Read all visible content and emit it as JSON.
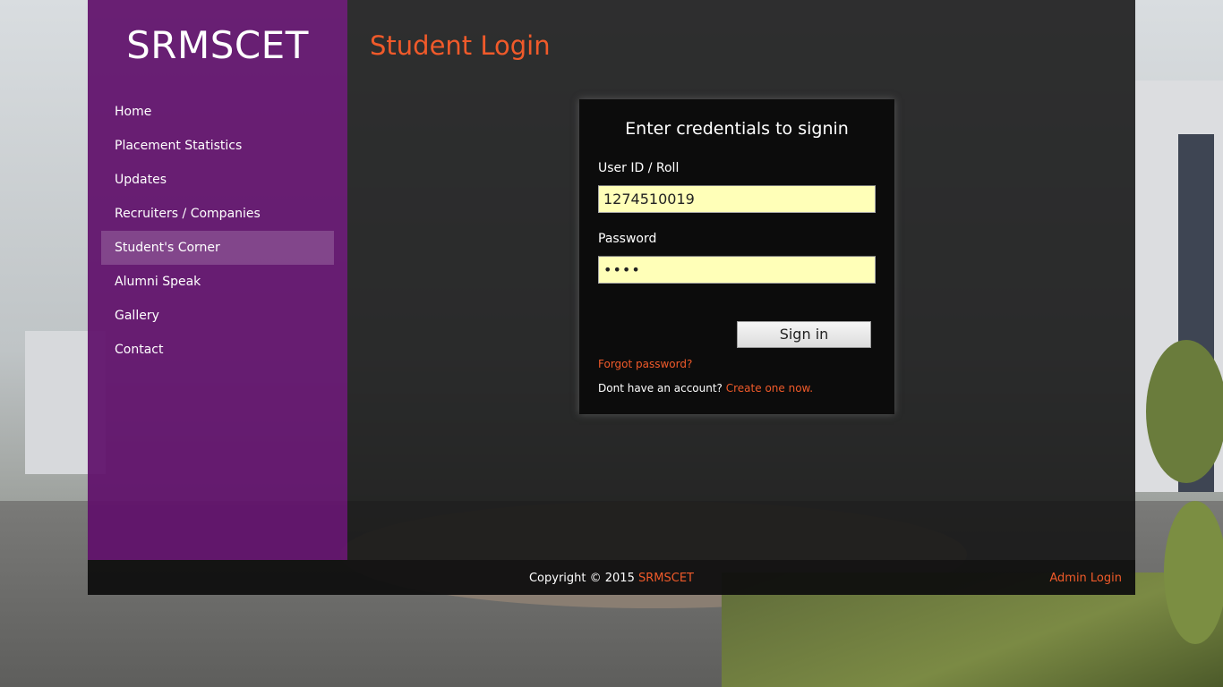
{
  "brand": {
    "name": "SRMSCET"
  },
  "nav": {
    "items": [
      {
        "label": "Home"
      },
      {
        "label": "Placement Statistics"
      },
      {
        "label": "Updates"
      },
      {
        "label": "Recruiters / Companies"
      },
      {
        "label": "Student's Corner",
        "active": true
      },
      {
        "label": "Alumni Speak"
      },
      {
        "label": "Gallery"
      },
      {
        "label": "Contact"
      }
    ]
  },
  "page": {
    "title": "Student Login"
  },
  "login": {
    "heading": "Enter credentials to signin",
    "user_label": "User ID / Roll",
    "user_value": "1274510019",
    "password_label": "Password",
    "password_value": "••••",
    "signin_label": "Sign in",
    "forgot_label": "Forgot password?",
    "no_account_text": "Dont have an account?",
    "create_label": "Create one now."
  },
  "footer": {
    "copyright_prefix": "Copyright © 2015",
    "copyright_brand": "SRMSCET",
    "admin_label": "Admin Login"
  },
  "colors": {
    "accent": "#f05a2a",
    "sidebar": "#60106a",
    "input_bg": "#ffffb8"
  }
}
